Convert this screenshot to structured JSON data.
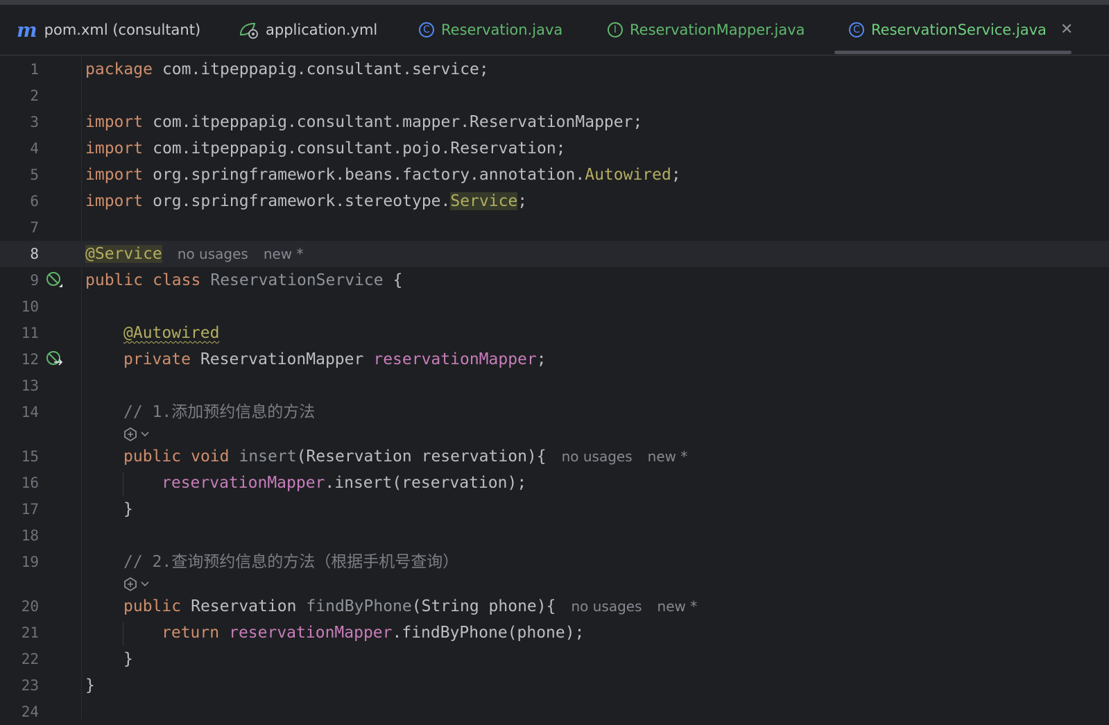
{
  "tabs": [
    {
      "name": "tab-pom-xml",
      "label": "pom.xml (consultant)",
      "icon": "maven-icon",
      "active": false
    },
    {
      "name": "tab-application-yml",
      "label": "application.yml",
      "icon": "spring-config-icon",
      "active": false
    },
    {
      "name": "tab-reservation-java",
      "label": "Reservation.java",
      "icon": "class-icon",
      "active": false
    },
    {
      "name": "tab-reservation-mapper-java",
      "label": "ReservationMapper.java",
      "icon": "interface-icon",
      "active": false
    },
    {
      "name": "tab-reservation-service-java",
      "label": "ReservationService.java",
      "icon": "class-icon",
      "active": true
    }
  ],
  "editor": {
    "current_line": 8,
    "lines": [
      {
        "n": "1",
        "t": [
          [
            "kw",
            "package"
          ],
          [
            "",
            "com.itpeppapig.consultant.service;"
          ]
        ]
      },
      {
        "n": "2",
        "t": []
      },
      {
        "n": "3",
        "t": [
          [
            "kw",
            "import"
          ],
          [
            "",
            "com.itpeppapig.consultant.mapper.ReservationMapper;"
          ]
        ]
      },
      {
        "n": "4",
        "t": [
          [
            "kw",
            "import"
          ],
          [
            "",
            "com.itpeppapig.consultant.pojo.Reservation;"
          ]
        ]
      },
      {
        "n": "5",
        "t": [
          [
            "kw",
            "import"
          ],
          [
            "",
            "org.springframework.beans.factory.annotation."
          ],
          [
            "ann",
            "Autowired"
          ],
          [
            "",
            ";"
          ]
        ]
      },
      {
        "n": "6",
        "t": [
          [
            "kw",
            "import"
          ],
          [
            "",
            "org.springframework.stereotype."
          ],
          [
            "svcbox",
            "Service"
          ],
          [
            "",
            ";"
          ]
        ]
      },
      {
        "n": "7",
        "t": []
      },
      {
        "n": "8",
        "t": [
          [
            "annbox",
            "@Service"
          ],
          [
            "hint",
            "no usages"
          ],
          [
            "hint",
            "new *"
          ]
        ]
      },
      {
        "n": "9",
        "t": [
          [
            "kw",
            "public"
          ],
          [
            "kw",
            "class"
          ],
          [
            "fnd",
            "ReservationService"
          ],
          [
            "",
            "{"
          ]
        ],
        "gutter": "bean-icon"
      },
      {
        "n": "10",
        "t": []
      },
      {
        "n": "11",
        "t": [
          [
            "ann wav",
            "@Autowired"
          ]
        ],
        "indent": 1
      },
      {
        "n": "12",
        "t": [
          [
            "kw",
            "private"
          ],
          [
            "",
            "ReservationMapper"
          ],
          [
            "fld",
            "reservationMapper"
          ],
          [
            "",
            ";"
          ]
        ],
        "indent": 1,
        "gutter": "autowired-bean-icon"
      },
      {
        "n": "13",
        "t": []
      },
      {
        "n": "14",
        "t": [
          [
            "cmt",
            "// 1.添加预约信息的方法"
          ]
        ],
        "indent": 1
      },
      {
        "n": "",
        "sub": true
      },
      {
        "n": "15",
        "t": [
          [
            "kw",
            "public"
          ],
          [
            "kw",
            "void"
          ],
          [
            "fnd",
            "insert"
          ],
          [
            "",
            "(Reservation reservation){"
          ],
          [
            "hint",
            "no usages"
          ],
          [
            "hint",
            "new *"
          ]
        ],
        "indent": 1
      },
      {
        "n": "16",
        "t": [
          [
            "fld",
            "reservationMapper"
          ],
          [
            "",
            ".insert(reservation);"
          ]
        ],
        "indent": 2
      },
      {
        "n": "17",
        "t": [
          [
            "",
            "}"
          ]
        ],
        "indent": 1
      },
      {
        "n": "18",
        "t": []
      },
      {
        "n": "19",
        "t": [
          [
            "cmt",
            "// 2.查询预约信息的方法（根据手机号查询）"
          ]
        ],
        "indent": 1
      },
      {
        "n": "",
        "sub": true
      },
      {
        "n": "20",
        "t": [
          [
            "kw",
            "public"
          ],
          [
            "",
            "Reservation"
          ],
          [
            "fnd",
            "findByPhone"
          ],
          [
            "",
            "(String phone){"
          ],
          [
            "hint",
            "no usages"
          ],
          [
            "hint",
            "new *"
          ]
        ],
        "indent": 1
      },
      {
        "n": "21",
        "t": [
          [
            "kw",
            "return"
          ],
          [
            "fld",
            "reservationMapper"
          ],
          [
            "",
            ".findByPhone(phone);"
          ]
        ],
        "indent": 2
      },
      {
        "n": "22",
        "t": [
          [
            "",
            "}"
          ]
        ],
        "indent": 1
      },
      {
        "n": "23",
        "t": [
          [
            "",
            "}"
          ]
        ]
      },
      {
        "n": "24",
        "t": []
      }
    ]
  },
  "colors": {
    "background": "#1e1f22",
    "keyword": "#cf8e6d",
    "annotation": "#b3ae60",
    "field": "#c77dbb",
    "comment": "#7a7e85",
    "active_tab_text": "#6fcf7f"
  }
}
